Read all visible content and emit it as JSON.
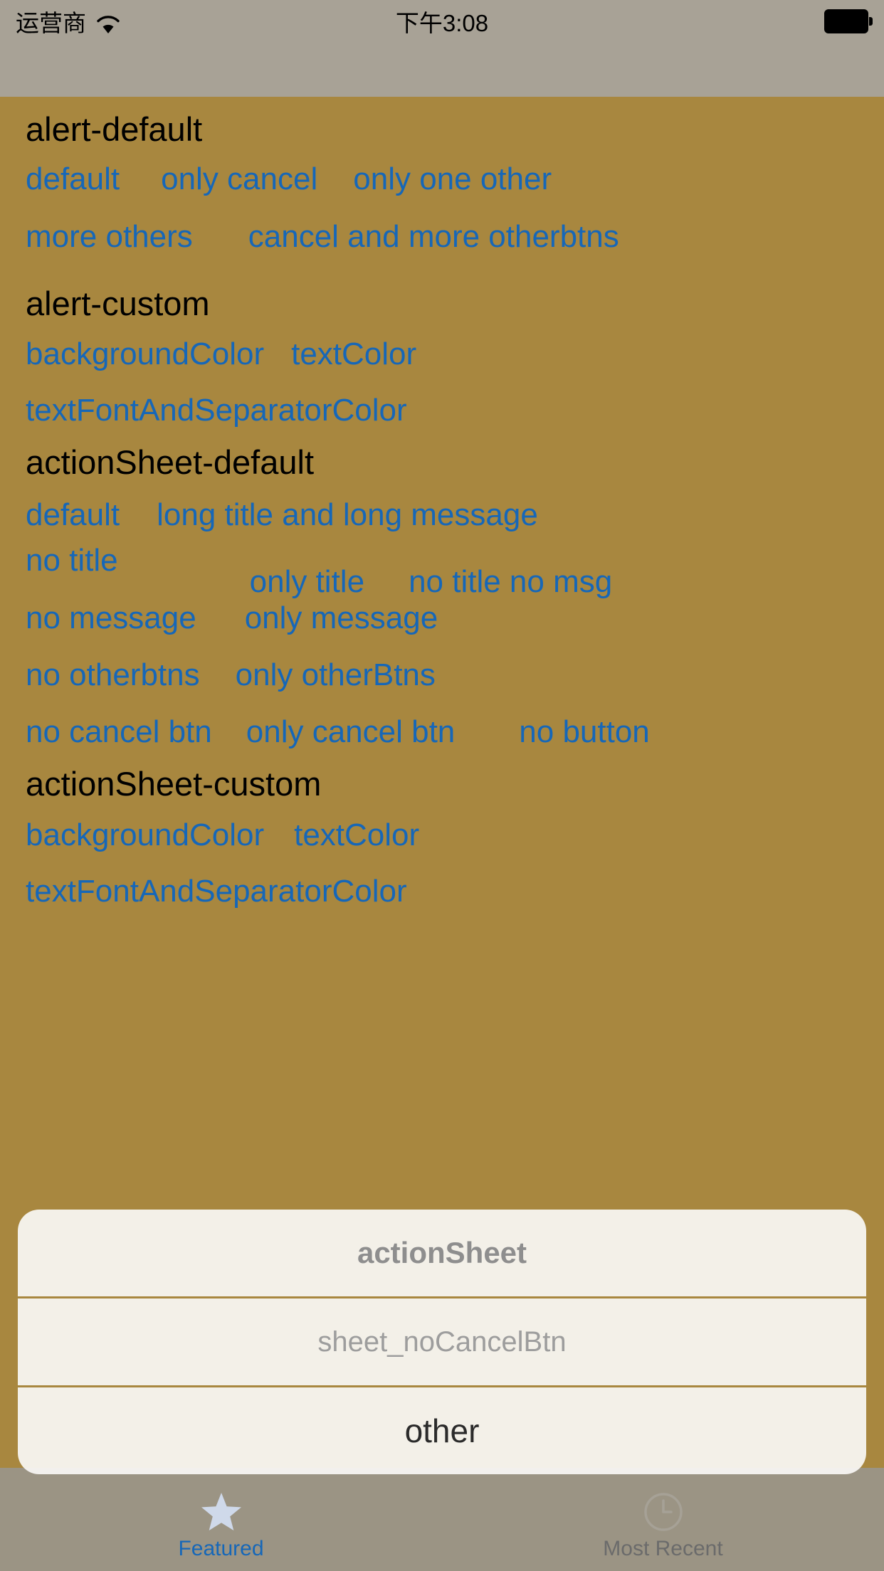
{
  "status_bar": {
    "carrier": "运营商",
    "wifi_icon": "wifi-icon",
    "time": "下午3:08",
    "battery_icon": "battery-full-icon"
  },
  "sections": [
    {
      "title": "alert-default",
      "rows": [
        [
          {
            "label": "default",
            "gap": 0
          },
          {
            "label": "only cancel",
            "gap": 58
          },
          {
            "label": "only one other",
            "gap": 50
          }
        ],
        [
          {
            "label": "more others",
            "gap": 0
          },
          {
            "label": "cancel and more otherbtns",
            "gap": 78
          }
        ]
      ]
    },
    {
      "title": "alert-custom",
      "rows": [
        [
          {
            "label": "backgroundColor",
            "gap": 0
          },
          {
            "label": "textColor",
            "gap": 38
          }
        ],
        [
          {
            "label": "textFontAndSeparatorColor",
            "gap": 0
          }
        ]
      ]
    },
    {
      "title": "actionSheet-default",
      "rows": [
        [
          {
            "label": "default",
            "gap": 0
          },
          {
            "label": "long title and long message",
            "gap": 52
          }
        ],
        [
          {
            "label": "no title",
            "gap": 0
          },
          {
            "label": "only title",
            "gap": 185
          },
          {
            "label": "no title no msg",
            "gap": 62
          }
        ],
        [
          {
            "label": "no message",
            "gap": 0
          },
          {
            "label": "only message",
            "gap": 68
          }
        ],
        [
          {
            "label": "no otherbtns",
            "gap": 0
          },
          {
            "label": "only otherBtns",
            "gap": 50
          }
        ],
        [
          {
            "label": "no cancel btn",
            "gap": 0
          },
          {
            "label": "only cancel btn",
            "gap": 48
          },
          {
            "label": "no button",
            "gap": 90
          }
        ]
      ]
    },
    {
      "title": "actionSheet-custom",
      "rows": [
        [
          {
            "label": "backgroundColor",
            "gap": 0
          },
          {
            "label": "textColor",
            "gap": 42
          }
        ],
        [
          {
            "label": "textFontAndSeparatorColor",
            "gap": 0
          }
        ]
      ]
    }
  ],
  "tab_bar": {
    "items": [
      {
        "label": "Featured",
        "icon": "star-icon"
      },
      {
        "label": "Most Recent",
        "icon": "clock-icon"
      }
    ]
  },
  "action_sheet": {
    "title": "actionSheet",
    "message": "sheet_noCancelBtn",
    "other_label": "other"
  },
  "colors": {
    "content_background": "#a8873f",
    "link_blue": "#1667b8",
    "separator": "#a8873f",
    "sheet_background": "#f9f8f5",
    "status_background": "#a8a296",
    "tabbar_background": "#9b9484"
  }
}
